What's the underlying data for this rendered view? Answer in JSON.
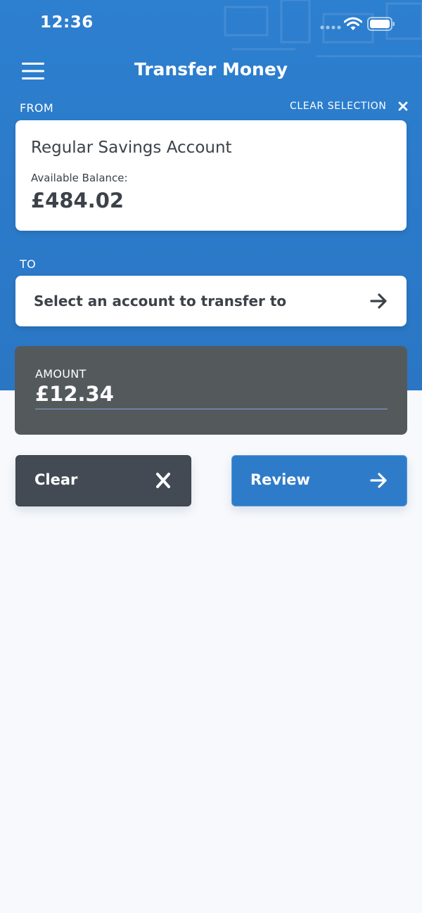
{
  "status": {
    "time": "12:36",
    "icons": [
      "signal-dots-icon",
      "wifi-icon",
      "battery-icon"
    ]
  },
  "header": {
    "title": "Transfer Money",
    "menu_icon": "hamburger-menu-icon"
  },
  "from": {
    "label": "FROM",
    "clear_selection": "CLEAR SELECTION",
    "account_name": "Regular Savings Account",
    "balance_label": "Available Balance:",
    "balance_value": "£484.02"
  },
  "to": {
    "label": "TO",
    "placeholder": "Select an account to transfer to",
    "icon": "arrow-right-icon"
  },
  "amount": {
    "label": "AMOUNT",
    "value": "£12.34"
  },
  "actions": {
    "clear_label": "Clear",
    "clear_icon": "close-icon",
    "review_label": "Review",
    "review_icon": "arrow-right-icon"
  },
  "colors": {
    "brand_blue": "#2d7fcf",
    "dark_card": "#545a5c",
    "clear_button": "#434a53",
    "review_button": "#2e7cc9",
    "text_dark": "#3c4249",
    "page_background": "#f7f9fc"
  }
}
